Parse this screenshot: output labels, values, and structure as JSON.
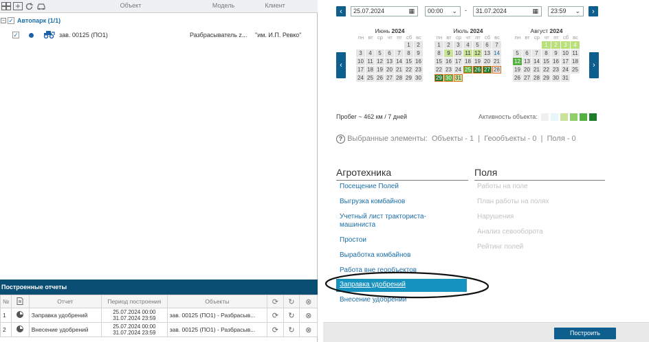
{
  "objects_grid": {
    "headers": {
      "object": "Объект",
      "model": "Модель",
      "client": "Клиент"
    },
    "group": {
      "label": "Автопарк",
      "count": "(1/1)"
    },
    "row": {
      "name": "зав. 00125 (ПО1)",
      "model": "Разбрасыватель z...",
      "client": "\"им. И.П. Ревко\""
    }
  },
  "reports": {
    "title": "Построенные отчеты",
    "headers": {
      "num": "№",
      "report": "Отчет",
      "period": "Период построения",
      "objects": "Объекты"
    },
    "rows": [
      {
        "num": "1",
        "report": "Заправка удобрений",
        "period_from": "25.07.2024 00:00",
        "period_to": "31.07.2024 23:59",
        "objects": "зав. 00125 (ПО1) - Разбрасыв..."
      },
      {
        "num": "2",
        "report": "Внесение удобрений",
        "period_from": "25.07.2024 00:00",
        "period_to": "31.07.2024 23:59",
        "objects": "зав. 00125 (ПО1) - Разбрасыв..."
      }
    ]
  },
  "period": {
    "date_from": "25.07.2024",
    "time_from": "00:00",
    "separator": "-",
    "date_to": "31.07.2024",
    "time_to": "23:59"
  },
  "calendar": {
    "weekdays": [
      "пн",
      "вт",
      "ср",
      "чт",
      "пт",
      "сб",
      "вс"
    ],
    "months": [
      {
        "name": "Июнь",
        "year": "2024"
      },
      {
        "name": "Июль",
        "year": "2024"
      },
      {
        "name": "Август",
        "year": "2024"
      }
    ]
  },
  "mileage": "Пробег ~ 462 км / 7 дней",
  "activity_label": "Активность объекта:",
  "activity_colors": [
    "#f0f0f0",
    "#e6f6fa",
    "#c9e39b",
    "#8fcf6a",
    "#55b042",
    "#1f7a2d"
  ],
  "selected": {
    "label": "Выбранные элементы:",
    "objects": "Объекты - 1",
    "geo": "Геообъекты - 0",
    "fields": "Поля - 0",
    "sep": "|"
  },
  "agro": {
    "title": "Агротехника",
    "items": [
      "Посещение Полей",
      "Выгрузка комбайнов",
      "Учетный лист тракториста-машиниста",
      "Простои",
      "Выработка комбайнов",
      "Работа вне геообъектов",
      "Заправка удобрений",
      "Внесение удобрений"
    ]
  },
  "fields": {
    "title": "Поля",
    "items": [
      "Работы на поле",
      "План работы на полях",
      "Нарушения",
      "Анализ севооборота",
      "Рейтинг полей"
    ]
  },
  "build_button": "Построить",
  "colors": {
    "accent": "#0e5f8e",
    "highlight": "#1592bd",
    "link": "#1b6ea8"
  }
}
